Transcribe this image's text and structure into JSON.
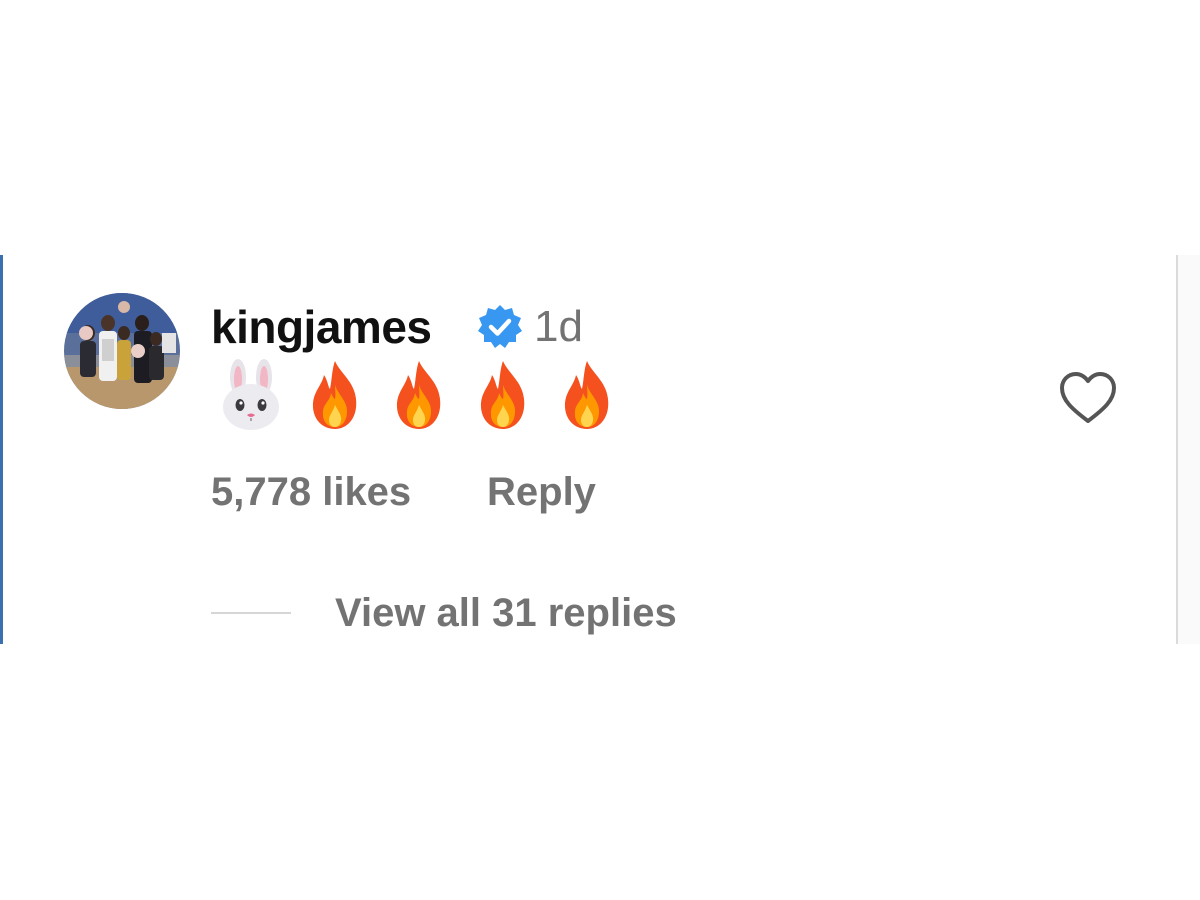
{
  "comment": {
    "username": "kingjames",
    "verified": true,
    "verified_icon": "verified-badge-icon",
    "timestamp": "1d",
    "emojis": [
      "rabbit-face",
      "fire",
      "fire",
      "fire",
      "fire"
    ],
    "likes_text": "5,778 likes",
    "reply_label": "Reply",
    "view_replies_label": "View all 31 replies",
    "liked": false
  },
  "colors": {
    "username": "#111111",
    "meta_text": "#737373",
    "verified_blue": "#3897f0",
    "divider": "#d6d6d6"
  }
}
